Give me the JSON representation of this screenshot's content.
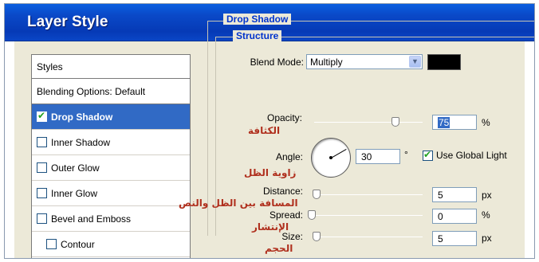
{
  "window": {
    "title": "Layer Style"
  },
  "styles_panel": {
    "header": "Styles",
    "items": [
      {
        "label": "Blending Options: Default",
        "checkbox": false,
        "checked": false,
        "selected": false
      },
      {
        "label": "Drop Shadow",
        "checkbox": true,
        "checked": true,
        "selected": true
      },
      {
        "label": "Inner Shadow",
        "checkbox": true,
        "checked": false,
        "selected": false
      },
      {
        "label": "Outer Glow",
        "checkbox": true,
        "checked": false,
        "selected": false
      },
      {
        "label": "Inner Glow",
        "checkbox": true,
        "checked": false,
        "selected": false
      },
      {
        "label": "Bevel and Emboss",
        "checkbox": true,
        "checked": false,
        "selected": false
      },
      {
        "label": "Contour",
        "checkbox": true,
        "checked": false,
        "selected": false
      }
    ]
  },
  "drop_shadow": {
    "group_title": "Drop Shadow",
    "structure_title": "Structure",
    "blend_mode": {
      "label": "Blend Mode:",
      "value": "Multiply",
      "color": "#000000"
    },
    "opacity": {
      "label": "Opacity:",
      "value": "75",
      "unit": "%",
      "slider_level": 0.75,
      "annotation": "الكثافة"
    },
    "angle": {
      "label": "Angle:",
      "value": "30",
      "unit": "°",
      "global_light_label": "Use Global Light",
      "global_light_checked": true,
      "annotation": "زاوية الظل"
    },
    "distance": {
      "label": "Distance:",
      "value": "5",
      "unit": "px",
      "annotation": "المسافة بين الظل والنص"
    },
    "spread": {
      "label": "Spread:",
      "value": "0",
      "unit": "%",
      "annotation": "الإنتشار"
    },
    "size": {
      "label": "Size:",
      "value": "5",
      "unit": "px",
      "annotation": "الحجم"
    }
  },
  "colors": {
    "titlebar": "#0a49c8",
    "selection": "#316ac5",
    "group_title": "#0033cc",
    "annotation": "#b0301e"
  }
}
